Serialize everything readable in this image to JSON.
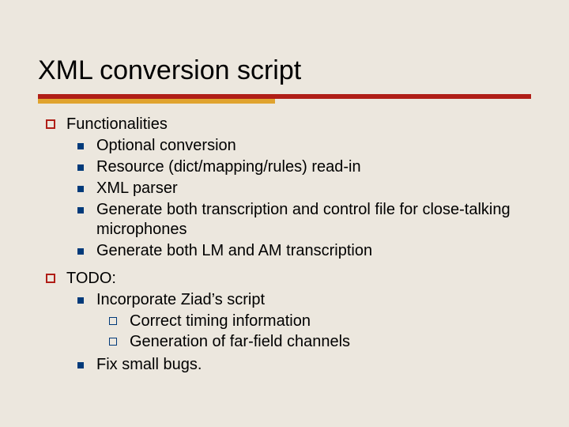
{
  "colors": {
    "accent_red": "#b01e17",
    "accent_orange": "#e0a32e",
    "bullet_blue": "#003a7a",
    "bg": "#ece7de"
  },
  "title": "XML conversion script",
  "sections": [
    {
      "label": "Functionalities",
      "items": [
        {
          "text": "Optional conversion"
        },
        {
          "text": "Resource (dict/mapping/rules) read-in"
        },
        {
          "text": "XML parser"
        },
        {
          "text": "Generate both transcription and control file for close-talking microphones"
        },
        {
          "text": "Generate both LM and AM transcription"
        }
      ]
    },
    {
      "label": "TODO:",
      "items": [
        {
          "text": "Incorporate Ziad’s script",
          "sub": [
            "Correct timing information",
            "Generation of far-field channels"
          ]
        },
        {
          "text": "Fix small bugs."
        }
      ]
    }
  ]
}
